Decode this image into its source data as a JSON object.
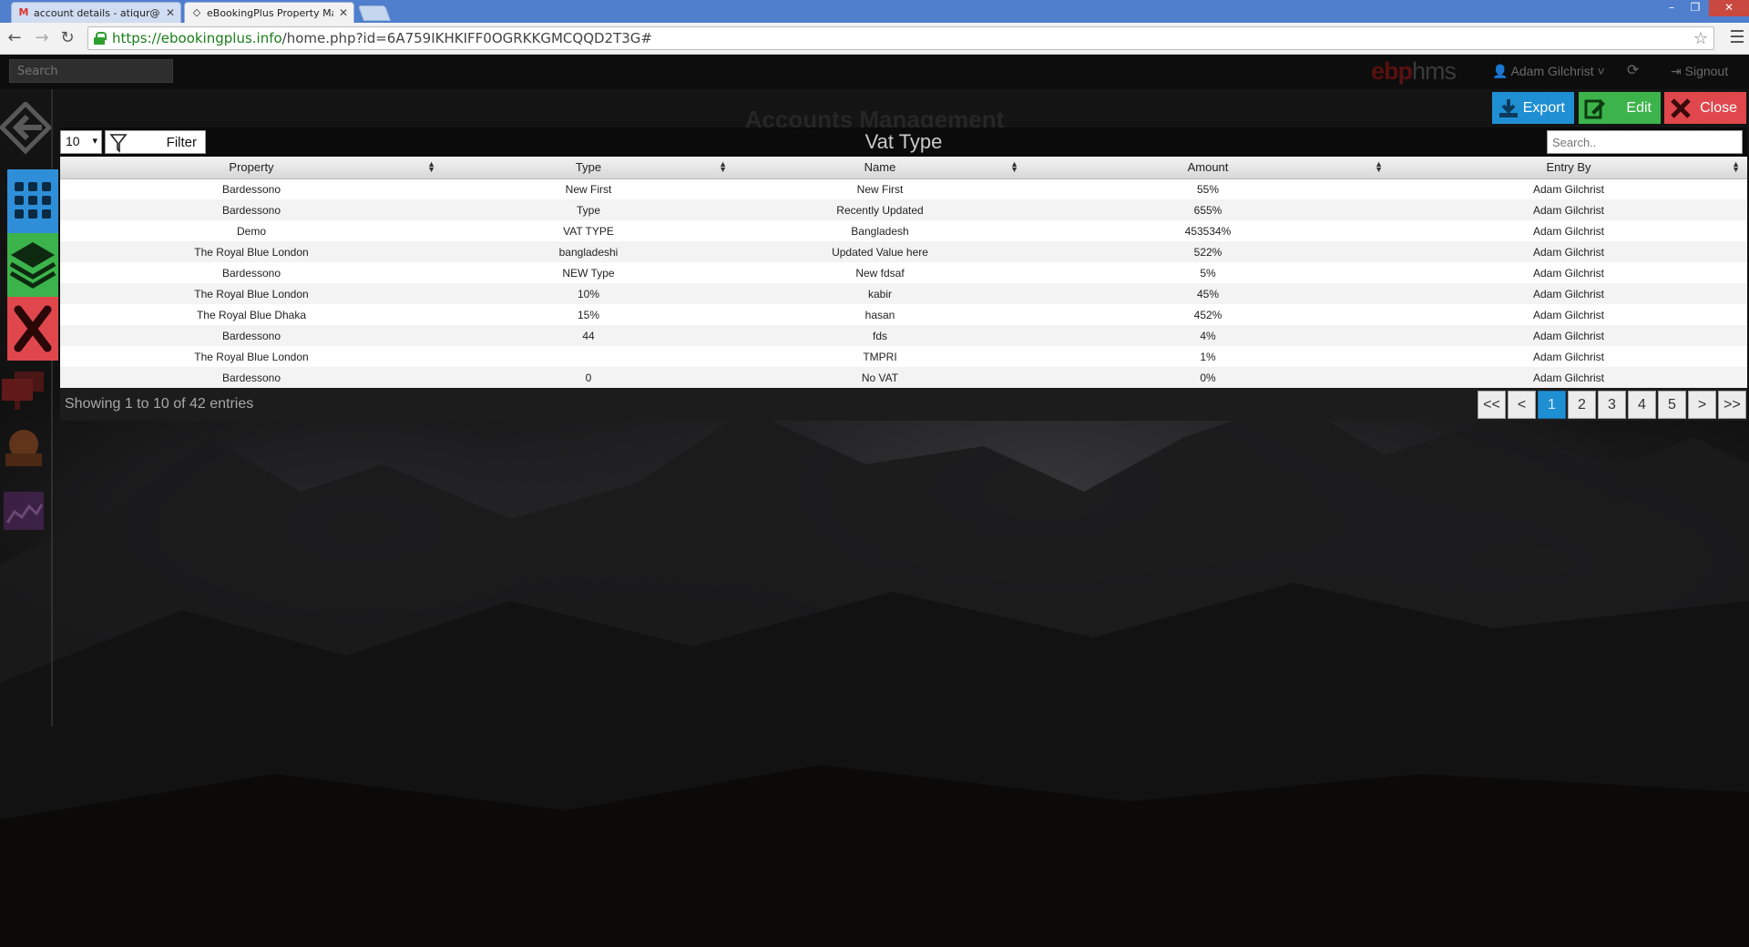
{
  "browser": {
    "tabs": [
      {
        "title": "account details - atiqur@ebo",
        "active": false
      },
      {
        "title": "eBookingPlus Property Mana",
        "active": true
      }
    ],
    "url_host": "https://ebookingplus.info",
    "url_path": "/home.php?id=6A759IKHKIFF0OGRKKGMCQQD2T3G#"
  },
  "topbar": {
    "search_placeholder": "Search",
    "brand_a": "ebp",
    "brand_b": "hms",
    "user": "Adam Gilchrist",
    "signout": "Signout"
  },
  "background_heading": "Accounts Management",
  "actions": {
    "export": "Export",
    "edit": "Edit",
    "close": "Close"
  },
  "table": {
    "page_length": "10",
    "filter_label": "Filter",
    "title": "Vat Type",
    "search_placeholder": "Search..",
    "columns": [
      "Property",
      "Type",
      "Name",
      "Amount",
      "Entry By"
    ],
    "rows": [
      [
        "Bardessono",
        "New First",
        "New First",
        "55%",
        "Adam Gilchrist"
      ],
      [
        "Bardessono",
        "Type",
        "Recently Updated",
        "655%",
        "Adam Gilchrist"
      ],
      [
        "Demo",
        "VAT TYPE",
        "Bangladesh",
        "453534%",
        "Adam Gilchrist"
      ],
      [
        "The Royal Blue London",
        "bangladeshi",
        "Updated Value here",
        "522%",
        "Adam Gilchrist"
      ],
      [
        "Bardessono",
        "NEW Type",
        "New fdsaf",
        "5%",
        "Adam Gilchrist"
      ],
      [
        "The Royal Blue London",
        "10%",
        "kabir",
        "45%",
        "Adam Gilchrist"
      ],
      [
        "The Royal Blue Dhaka",
        "15%",
        "hasan",
        "452%",
        "Adam Gilchrist"
      ],
      [
        "Bardessono",
        "44",
        "fds",
        "4%",
        "Adam Gilchrist"
      ],
      [
        "The Royal Blue London",
        "",
        "TMPRI",
        "1%",
        "Adam Gilchrist"
      ],
      [
        "Bardessono",
        "0",
        "No VAT",
        "0%",
        "Adam Gilchrist"
      ]
    ],
    "info": "Showing 1 to 10 of 42 entries",
    "pager": [
      "<<",
      "<",
      "1",
      "2",
      "3",
      "4",
      "5",
      ">",
      ">>"
    ],
    "current_page": "1"
  },
  "colors": {
    "blue": "#2e8fd8",
    "green": "#3cb44b",
    "red": "#e0474c"
  }
}
